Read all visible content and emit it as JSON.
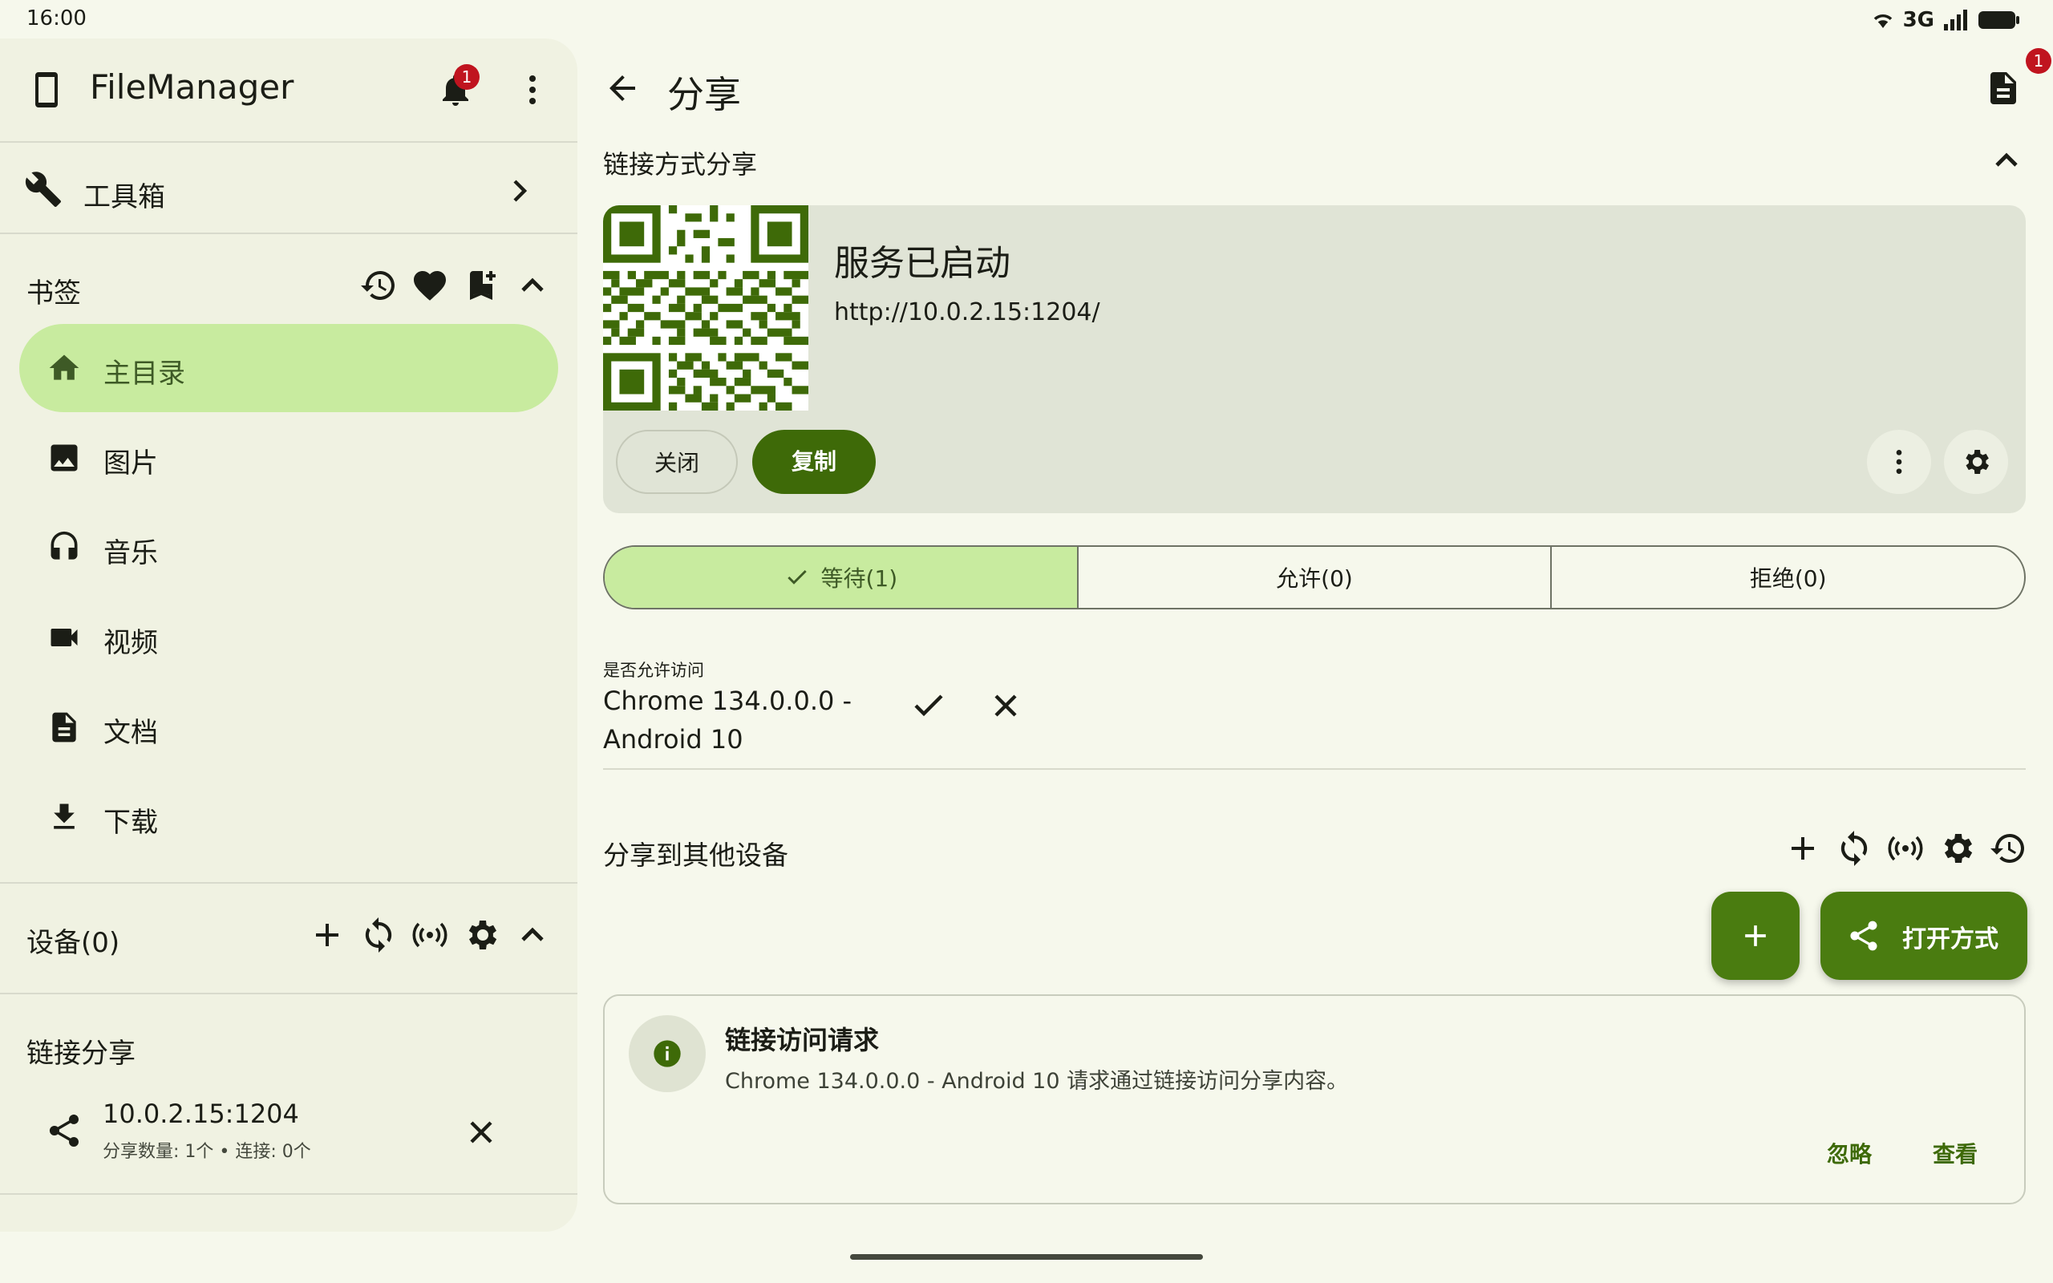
{
  "status_bar": {
    "time": "16:00",
    "network": "3G"
  },
  "sidebar": {
    "app_title": "FileManager",
    "notification_count": "1",
    "toolbox_label": "工具箱",
    "bookmarks": {
      "label": "书签",
      "items": [
        {
          "label": "主目录",
          "icon": "home-icon",
          "active": true
        },
        {
          "label": "图片",
          "icon": "image-icon"
        },
        {
          "label": "音乐",
          "icon": "headphones-icon"
        },
        {
          "label": "视频",
          "icon": "video-icon"
        },
        {
          "label": "文档",
          "icon": "document-icon"
        },
        {
          "label": "下载",
          "icon": "download-icon"
        }
      ]
    },
    "devices_label": "设备(0)",
    "link_share": {
      "label": "链接分享",
      "address": "10.0.2.15:1204",
      "stats": "分享数量: 1个 • 连接: 0个"
    }
  },
  "main": {
    "title": "分享",
    "log_badge": "1",
    "link_section_title": "链接方式分享",
    "service_status": "服务已启动",
    "service_url": "http://10.0.2.15:1204/",
    "close_label": "关闭",
    "copy_label": "复制",
    "segments": [
      "等待(1)",
      "允许(0)",
      "拒绝(0)"
    ],
    "request": {
      "caption": "是否允许访问",
      "device": "Chrome 134.0.0.0 - Android 10"
    },
    "other_devices_title": "分享到其他设备",
    "open_with_label": "打开方式",
    "notification": {
      "title": "链接访问请求",
      "body": "Chrome 134.0.0.0 - Android 10 请求通过链接访问分享内容。",
      "ignore_label": "忽略",
      "view_label": "查看"
    }
  },
  "colors": {
    "background": "#f6f8ec",
    "sidebar": "#f0f2e2",
    "accent": "#3e6a08",
    "active_pill": "#c8eb9f",
    "badge": "#c0141f"
  }
}
